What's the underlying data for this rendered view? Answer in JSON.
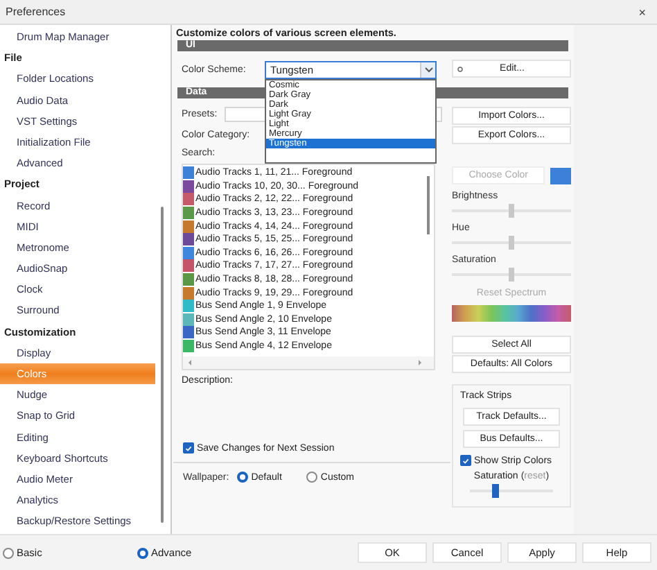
{
  "window": {
    "title": "Preferences",
    "close": "×"
  },
  "sidebar": {
    "items": [
      {
        "label": "Drum Map Manager",
        "kind": "item",
        "selected": false
      },
      {
        "label": "File",
        "kind": "heading",
        "selected": false
      },
      {
        "label": "Folder Locations",
        "kind": "item",
        "selected": false
      },
      {
        "label": "Audio Data",
        "kind": "item",
        "selected": false
      },
      {
        "label": "VST Settings",
        "kind": "item",
        "selected": false
      },
      {
        "label": "Initialization File",
        "kind": "item",
        "selected": false
      },
      {
        "label": "Advanced",
        "kind": "item",
        "selected": false
      },
      {
        "label": "Project",
        "kind": "heading",
        "selected": false
      },
      {
        "label": "Record",
        "kind": "item",
        "selected": false
      },
      {
        "label": "MIDI",
        "kind": "item",
        "selected": false
      },
      {
        "label": "Metronome",
        "kind": "item",
        "selected": false
      },
      {
        "label": "AudioSnap",
        "kind": "item",
        "selected": false
      },
      {
        "label": "Clock",
        "kind": "item",
        "selected": false
      },
      {
        "label": "Surround",
        "kind": "item",
        "selected": false
      },
      {
        "label": "Customization",
        "kind": "heading",
        "selected": false
      },
      {
        "label": "Display",
        "kind": "item",
        "selected": false
      },
      {
        "label": "Colors",
        "kind": "item",
        "selected": true
      },
      {
        "label": "Nudge",
        "kind": "item",
        "selected": false
      },
      {
        "label": "Snap to Grid",
        "kind": "item",
        "selected": false
      },
      {
        "label": "Editing",
        "kind": "item",
        "selected": false
      },
      {
        "label": "Keyboard Shortcuts",
        "kind": "item",
        "selected": false
      },
      {
        "label": "Audio Meter",
        "kind": "item",
        "selected": false
      },
      {
        "label": "Analytics",
        "kind": "item",
        "selected": false
      },
      {
        "label": "Backup/Restore Settings",
        "kind": "item",
        "selected": false
      }
    ]
  },
  "heading": "Customize colors of various screen elements.",
  "ui_section": {
    "title": "UI",
    "color_scheme_label": "Color Scheme:",
    "color_scheme": {
      "value": "Tungsten",
      "expanded": true,
      "options": [
        {
          "label": "Cosmic",
          "selected": false
        },
        {
          "label": "Dark Gray",
          "selected": false
        },
        {
          "label": "Dark",
          "selected": false
        },
        {
          "label": "Light Gray",
          "selected": false
        },
        {
          "label": "Light",
          "selected": false
        },
        {
          "label": "Mercury",
          "selected": false
        },
        {
          "label": "Tungsten",
          "selected": true
        }
      ]
    },
    "edit_button": "Edit..."
  },
  "data_section": {
    "title": "Data",
    "presets_label": "Presets:",
    "color_category_label": "Color Category:",
    "search_label": "Search:",
    "import_button": "Import Colors...",
    "export_button": "Export Colors...",
    "items": [
      {
        "label": "Audio Tracks 1, 11, 21... Foreground",
        "color": "#3d80d8"
      },
      {
        "label": "Audio Tracks 10, 20, 30... Foreground",
        "color": "#7b4a9c"
      },
      {
        "label": "Audio Tracks 2, 12, 22... Foreground",
        "color": "#c45a6a"
      },
      {
        "label": "Audio Tracks 3, 13, 23... Foreground",
        "color": "#5a984a"
      },
      {
        "label": "Audio Tracks 4, 14, 24... Foreground",
        "color": "#c6782c"
      },
      {
        "label": "Audio Tracks 5, 15, 25... Foreground",
        "color": "#6c4a98"
      },
      {
        "label": "Audio Tracks 6, 16, 26... Foreground",
        "color": "#3f86de"
      },
      {
        "label": "Audio Tracks 7, 17, 27... Foreground",
        "color": "#c45468"
      },
      {
        "label": "Audio Tracks 8, 18, 28... Foreground",
        "color": "#5a9848"
      },
      {
        "label": "Audio Tracks 9, 19, 29... Foreground",
        "color": "#c87a2c"
      },
      {
        "label": "Bus Send Angle 1, 9 Envelope",
        "color": "#2fbcc8"
      },
      {
        "label": "Bus Send Angle 2, 10 Envelope",
        "color": "#5cb8b8"
      },
      {
        "label": "Bus Send Angle 3, 11 Envelope",
        "color": "#3a66c4"
      },
      {
        "label": "Bus Send Angle 4, 12 Envelope",
        "color": "#3ab866"
      }
    ],
    "description_label": "Description:",
    "save_changes": {
      "label": "Save Changes for Next Session",
      "checked": true
    },
    "wallpaper": {
      "label": "Wallpaper:",
      "options": [
        {
          "label": "Default",
          "selected": true
        },
        {
          "label": "Custom",
          "selected": false
        }
      ]
    }
  },
  "color_panel": {
    "choose_color": {
      "label": "Choose Color",
      "disabled": true,
      "color": "#3d80d8"
    },
    "sliders": [
      {
        "label": "Brightness",
        "level": 0.5
      },
      {
        "label": "Hue",
        "level": 0.5
      },
      {
        "label": "Saturation",
        "level": 0.5
      }
    ],
    "reset_spectrum": {
      "label": "Reset Spectrum",
      "disabled": true
    },
    "select_all": "Select All",
    "defaults_all": "Defaults: All Colors",
    "track_strips": {
      "title": "Track Strips",
      "track_defaults": "Track Defaults...",
      "bus_defaults": "Bus Defaults...",
      "show_strip_colors": {
        "label": "Show Strip Colors",
        "checked": true
      },
      "saturation": {
        "label": "Saturation",
        "open_paren": "(",
        "reset_link": "reset",
        "close_paren": ")",
        "level": 0.3
      }
    }
  },
  "mode": [
    {
      "label": "Basic",
      "selected": false
    },
    {
      "label": "Advance",
      "selected": true
    }
  ],
  "footer_buttons": [
    "OK",
    "Cancel",
    "Apply",
    "Help"
  ]
}
